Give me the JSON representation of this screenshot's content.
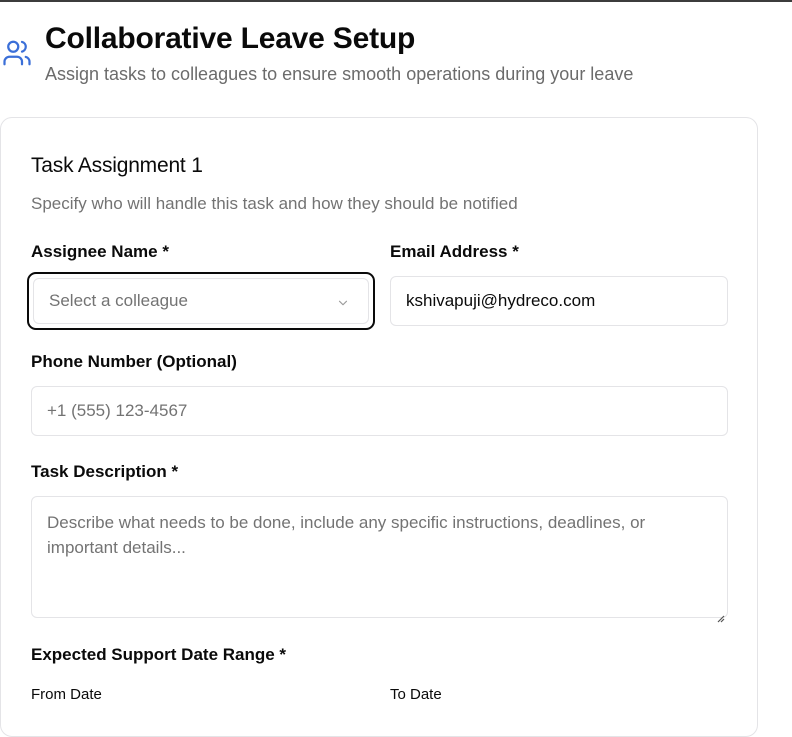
{
  "header": {
    "icon": "users-icon",
    "title": "Collaborative Leave Setup",
    "subtitle": "Assign tasks to colleagues to ensure smooth operations during your leave"
  },
  "task": {
    "title": "Task Assignment 1",
    "description": "Specify who will handle this task and how they should be notified",
    "assignee": {
      "label": "Assignee Name *",
      "placeholder": "Select a colleague"
    },
    "email": {
      "label": "Email Address *",
      "value": "kshivapuji@hydreco.com"
    },
    "phone": {
      "label": "Phone Number (Optional)",
      "placeholder": "+1 (555) 123-4567"
    },
    "task_description": {
      "label": "Task Description *",
      "placeholder": "Describe what needs to be done, include any specific instructions, deadlines, or important details..."
    },
    "date_range": {
      "label": "Expected Support Date Range *",
      "from_label": "From Date",
      "to_label": "To Date"
    }
  },
  "colors": {
    "accent": "#3b6fd8",
    "border": "#e4e4e7",
    "muted_text": "#737373",
    "focus_ring": "#0a0a0a"
  }
}
